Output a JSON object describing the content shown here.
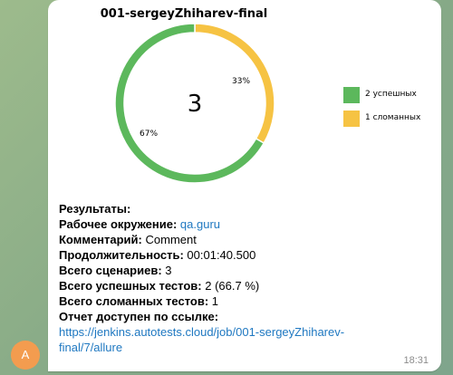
{
  "chart_data": {
    "type": "pie",
    "title": "001-sergeyZhiharev-final",
    "center_value": "3",
    "slices": [
      {
        "label": "2 успешных",
        "value": 2,
        "percent_label": "67%",
        "color": "#5cb85c"
      },
      {
        "label": "1 сломанных",
        "value": 1,
        "percent_label": "33%",
        "color": "#f6c343"
      }
    ],
    "legend_position": "right"
  },
  "info": {
    "results_label": "Результаты:",
    "env_label": "Рабочее окружение:",
    "env_value": "qa.guru",
    "comment_label": "Комментарий:",
    "comment_value": "Comment",
    "duration_label": "Продолжительность:",
    "duration_value": "00:01:40.500",
    "scenarios_label": "Всего сценариев:",
    "scenarios_value": "3",
    "passed_label": "Всего успешных тестов:",
    "passed_value": "2 (66.7 %)",
    "broken_label": "Всего сломанных тестов:",
    "broken_value": "1",
    "report_label": "Отчет доступен по ссылке:",
    "report_link": "https://jenkins.autotests.cloud/job/001-sergeyZhiharev-final/7/allure"
  },
  "message": {
    "time": "18:31",
    "avatar_letter": "A",
    "avatar_color": "#f39c4f"
  }
}
